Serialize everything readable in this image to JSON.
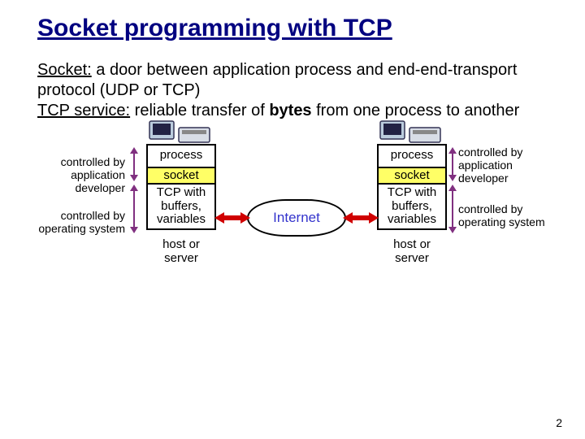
{
  "title": "Socket programming with TCP",
  "definitions": {
    "socket_term": "Socket:",
    "socket_text_a": " a door between application process and end-end-transport protocol (UDP or TCP)",
    "tcp_term": "TCP service:",
    "tcp_text_a": " reliable transfer of ",
    "tcp_bold": "bytes",
    "tcp_text_b": " from one process to another"
  },
  "annotations": {
    "left_top": "controlled by application developer",
    "left_bottom": "controlled by operating system",
    "right_top": "controlled by application developer",
    "right_bottom": "controlled by operating system"
  },
  "host": {
    "left": {
      "process": "process",
      "socket": "socket",
      "tcp": "TCP with buffers, variables",
      "label": "host or server"
    },
    "right": {
      "process": "process",
      "socket": "socket",
      "tcp": "TCP with buffers, variables",
      "label": "host or server"
    }
  },
  "network_label": "Internet",
  "page_number": "2"
}
